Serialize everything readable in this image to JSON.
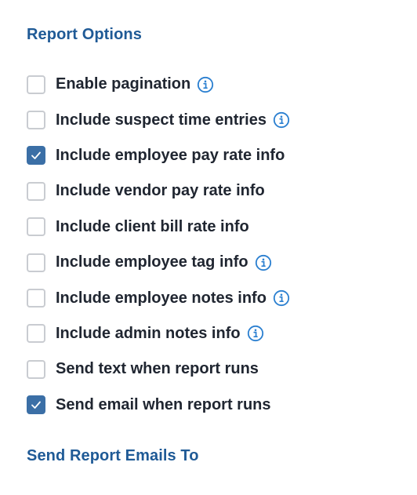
{
  "report_options": {
    "heading": "Report Options",
    "items": [
      {
        "label": "Enable pagination",
        "checked": false,
        "info": true
      },
      {
        "label": "Include suspect time entries",
        "checked": false,
        "info": true
      },
      {
        "label": "Include employee pay rate info",
        "checked": true,
        "info": false
      },
      {
        "label": "Include vendor pay rate info",
        "checked": false,
        "info": false
      },
      {
        "label": "Include client bill rate info",
        "checked": false,
        "info": false
      },
      {
        "label": "Include employee tag info",
        "checked": false,
        "info": true
      },
      {
        "label": "Include employee notes info",
        "checked": false,
        "info": true
      },
      {
        "label": "Include admin notes info",
        "checked": false,
        "info": true
      },
      {
        "label": "Send text when report runs",
        "checked": false,
        "info": false
      },
      {
        "label": "Send email when report runs",
        "checked": true,
        "info": false
      }
    ]
  },
  "send_report_emails": {
    "heading": "Send Report Emails To"
  },
  "icons": {
    "info": "info-circle-icon",
    "check": "checkmark-icon"
  },
  "colors": {
    "heading": "#1f5a96",
    "checkbox_checked": "#3b6fa6",
    "checkbox_border": "#c9ccd1",
    "info_icon": "#2a7fd0",
    "label_text": "#202631"
  }
}
